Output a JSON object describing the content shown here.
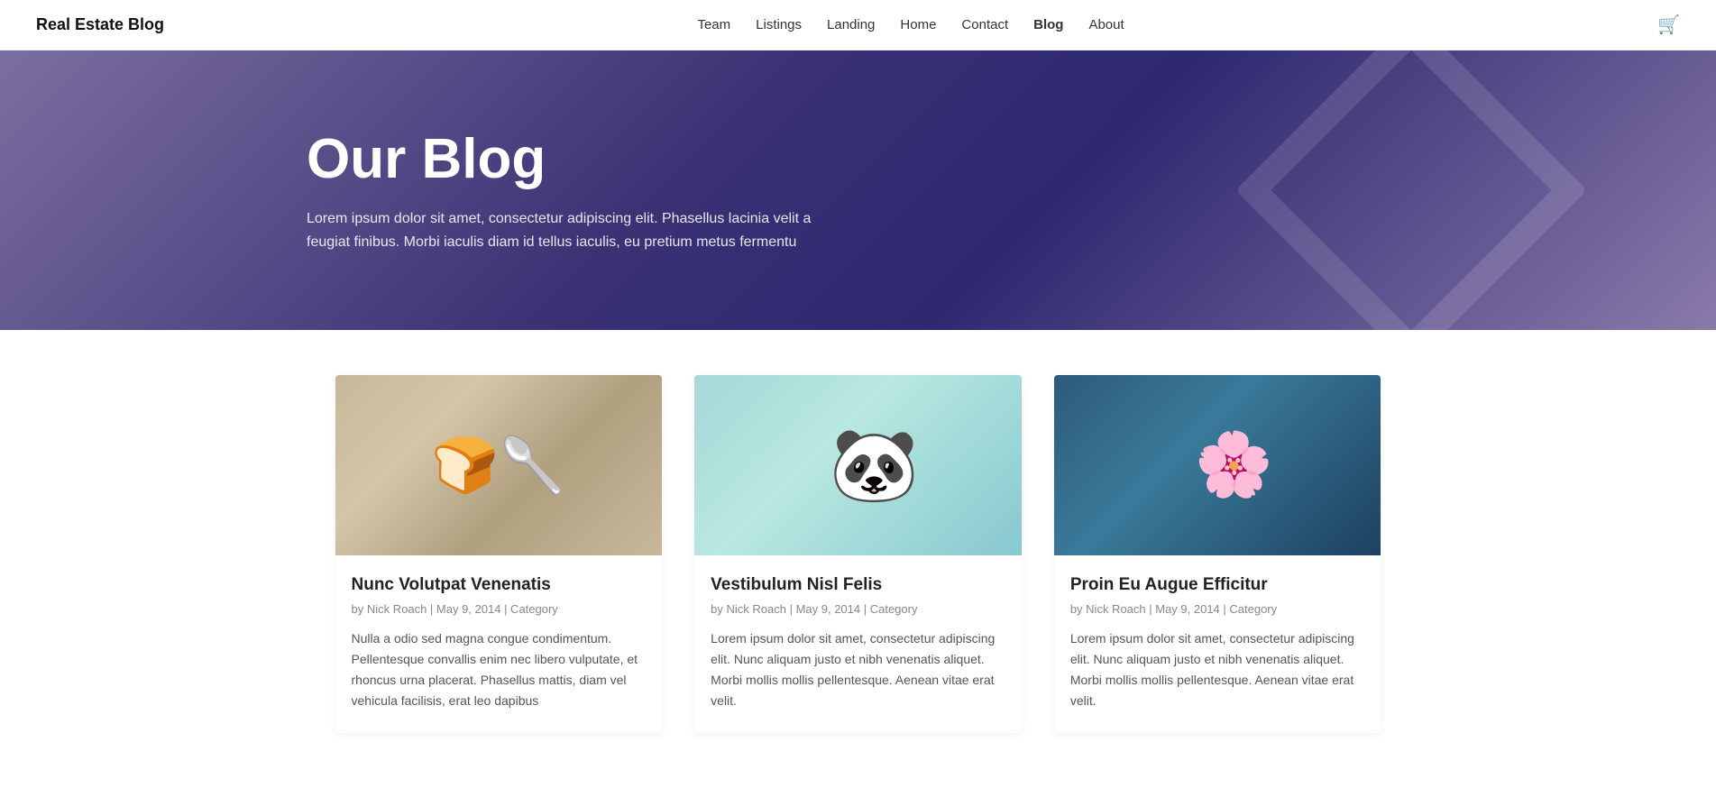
{
  "brand": "Real Estate Blog",
  "nav": {
    "links": [
      {
        "id": "team",
        "label": "Team",
        "active": false
      },
      {
        "id": "listings",
        "label": "Listings",
        "active": false
      },
      {
        "id": "landing",
        "label": "Landing",
        "active": false
      },
      {
        "id": "home",
        "label": "Home",
        "active": false
      },
      {
        "id": "contact",
        "label": "Contact",
        "active": false
      },
      {
        "id": "blog",
        "label": "Blog",
        "active": true
      },
      {
        "id": "about",
        "label": "About",
        "active": false
      }
    ],
    "cart_icon": "🛒"
  },
  "hero": {
    "title": "Our Blog",
    "description": "Lorem ipsum dolor sit amet, consectetur adipiscing elit. Phasellus lacinia velit a feugiat finibus. Morbi iaculis diam id tellus iaculis, eu pretium metus fermentu"
  },
  "blog": {
    "posts": [
      {
        "id": "post-1",
        "title": "Nunc Volutpat Venenatis",
        "author": "Nick Roach",
        "date": "May 9, 2014",
        "category": "Category",
        "text": "Nulla a odio sed magna congue condimentum. Pellentesque convallis enim nec libero vulputate, et rhoncus urna placerat. Phasellus mattis, diam vel vehicula facilisis, erat leo dapibus",
        "image_style": "card-img-1"
      },
      {
        "id": "post-2",
        "title": "Vestibulum Nisl Felis",
        "author": "Nick Roach",
        "date": "May 9, 2014",
        "category": "Category",
        "text": "Lorem ipsum dolor sit amet, consectetur adipiscing elit. Nunc aliquam justo et nibh venenatis aliquet. Morbi mollis mollis pellentesque. Aenean vitae erat velit.",
        "image_style": "card-img-2"
      },
      {
        "id": "post-3",
        "title": "Proin Eu Augue Efficitur",
        "author": "Nick Roach",
        "date": "May 9, 2014",
        "category": "Category",
        "text": "Lorem ipsum dolor sit amet, consectetur adipiscing elit. Nunc aliquam justo et nibh venenatis aliquet. Morbi mollis mollis pellentesque. Aenean vitae erat velit.",
        "image_style": "card-img-3"
      }
    ]
  }
}
